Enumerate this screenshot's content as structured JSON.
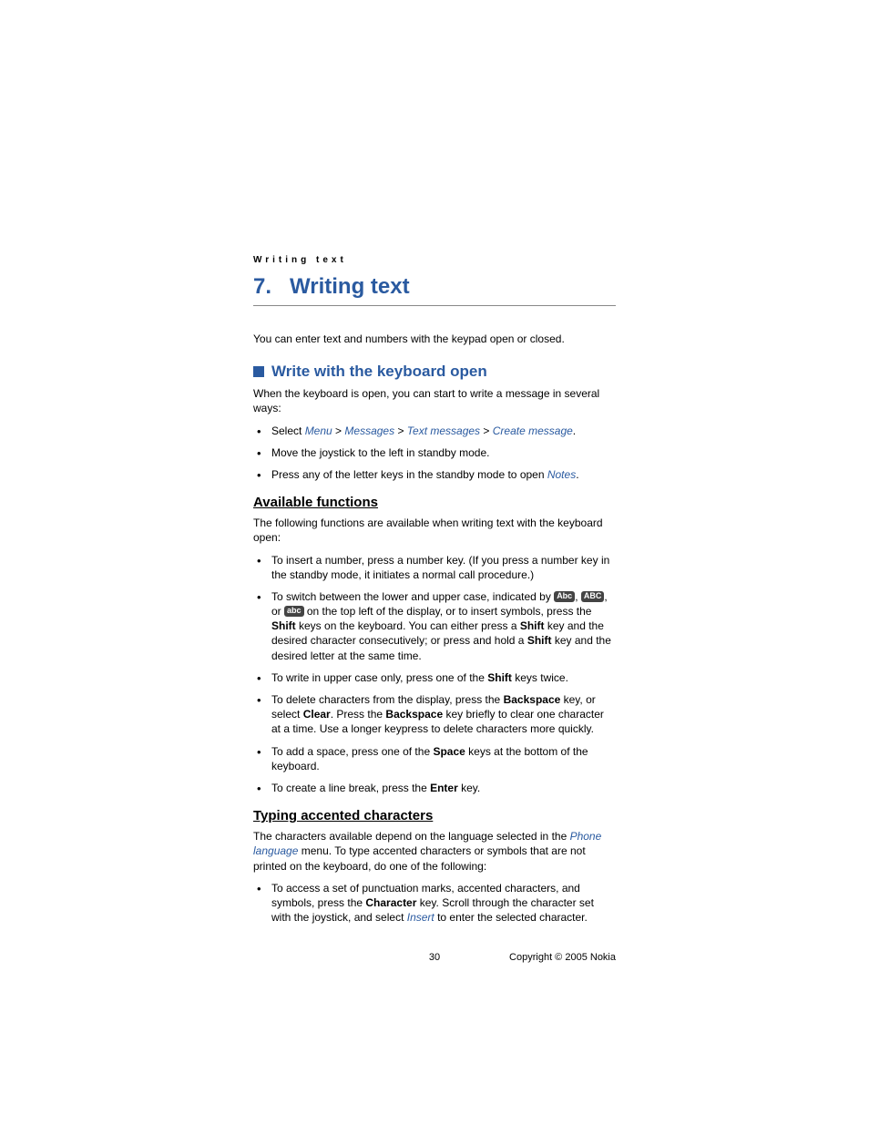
{
  "pageHeader": "Writing text",
  "chapter": {
    "num": "7.",
    "title": "Writing text"
  },
  "intro": "You can enter text and numbers with the keypad open or closed.",
  "section1": {
    "heading": "Write with the keyboard open",
    "lead": "When the keyboard is open, you can start to write a message in several ways:",
    "bullet1_prefix": "Select ",
    "link_menu": "Menu",
    "link_messages": "Messages",
    "link_textmsgs": "Text messages",
    "link_createmsg": "Create message",
    "bullet2": "Move the joystick to the left in standby mode.",
    "bullet3_prefix": "Press any of the letter keys in the standby mode to open ",
    "link_notes": "Notes"
  },
  "availFunctions": {
    "heading": "Available functions",
    "lead": "The following functions are available when writing text with the keyboard open:",
    "b1": "To insert a number, press a number key. (If you press a number key in the standby mode, it initiates a normal call procedure.)",
    "b2_a": "To switch between the lower and upper case, indicated by ",
    "b2_b_comma": ",  ",
    "b2_c": ", or ",
    "b2_d": " on the top left of the display, or to insert symbols, press the ",
    "shift": "Shift",
    "b2_e": " keys on the keyboard. You can either press a ",
    "b2_f": " key and the desired character consecutively; or press and hold a ",
    "b2_g": " key and the desired letter at the same time.",
    "b3_a": "To write in upper case only, press one of the ",
    "b3_b": " keys twice.",
    "b4_a": "To delete characters from the display, press the ",
    "backspace": "Backspace",
    "b4_b": " key, or select ",
    "clear": "Clear",
    "b4_c": ". Press the ",
    "b4_d": " key briefly to clear one character at a time. Use a longer keypress to delete characters more quickly.",
    "b5_a": "To add a space, press one of the ",
    "space": "Space",
    "b5_b": " keys at the bottom of the keyboard.",
    "b6_a": "To create a line break, press the ",
    "enter": "Enter",
    "b6_b": " key."
  },
  "accented": {
    "heading": "Typing accented characters",
    "lead_a": "The characters available depend on the language selected in the ",
    "link_phonelang": "Phone language",
    "lead_b": " menu. To type accented characters or symbols that are not printed on the keyboard, do one of the following:",
    "b1_a": "To access a set of punctuation marks, accented characters, and symbols, press the ",
    "character": "Character",
    "b1_b": " key. Scroll through the character set with the joystick, and select ",
    "link_insert": "Insert",
    "b1_c": " to enter the selected character."
  },
  "indicators": {
    "abc_mixed": "Abc",
    "abc_upper": "ABC",
    "abc_lower": "abc"
  },
  "footer": {
    "pagenum": "30",
    "copyright": "Copyright © 2005 Nokia"
  }
}
